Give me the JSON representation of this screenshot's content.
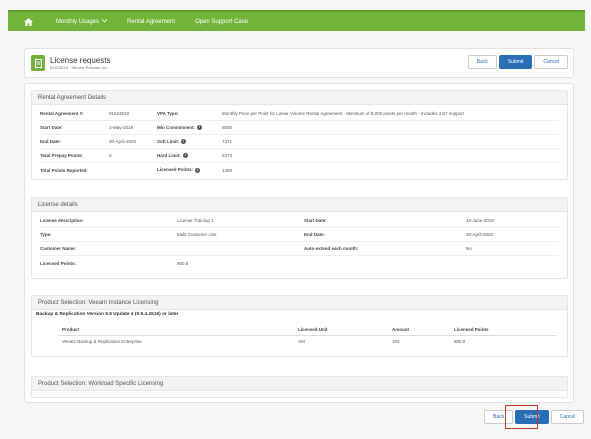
{
  "nav": {
    "items": [
      "Monthly Usages",
      "Rental Agreement",
      "Open Support Case"
    ]
  },
  "header": {
    "title": "License requests",
    "subtitle": "81623918 · Service Provider Inc",
    "back": "Back",
    "submit": "Submit",
    "cancel": "Cancel"
  },
  "rental": {
    "section_title": "Rental Agreement Details",
    "agreement_label": "Rental Agreement #:",
    "agreement_value": "01623918",
    "vpa_label": "VPA Type:",
    "vpa_value": "Monthly Price per Point for Linear Volume Rental Agreement - Minimum of 8,000 points per month - Includes 24/7 support",
    "start_label": "Start Date:",
    "start_value": "1-May-2019",
    "min_label": "Min Commitment:",
    "min_value": "5000",
    "end_label": "End Date:",
    "end_value": "30-April-2020",
    "soft_label": "Soft Limit:",
    "soft_value": "7371",
    "prepay_label": "Total Prepay Points:",
    "prepay_value": "0",
    "hard_label": "Hard Limit:",
    "hard_value": "8373",
    "reported_label": "Total Points Reported:",
    "licensed_label": "Licensed Points:",
    "licensed_value": "1400"
  },
  "license": {
    "section_title": "License details",
    "desc_label": "License description:",
    "desc_value": "License Training 1",
    "start_label": "Start Date:",
    "start_value": "16-June-2019",
    "type_label": "Type:",
    "type_value": "Multi Customer Use",
    "end_label": "End Date:",
    "end_value": "30-April-2020",
    "customer_label": "Customer Name:",
    "auto_label": "Auto-extend each month:",
    "auto_value": "No",
    "points_label": "Licensed Points:",
    "points_value": "900.0"
  },
  "product1": {
    "section_title": "Product Selection: Veeam Instance Licensing",
    "group": "Backup & Replication Version 9.5 Update 4 (9.5.4.2615) or later",
    "headers": [
      "Product",
      "Licensed Unit",
      "Amount",
      "Licensed Points"
    ],
    "row": [
      "Veeam Backup & Replication Enterprise",
      "VM",
      "100",
      "900.0"
    ]
  },
  "product2": {
    "section_title": "Product Selection: Workload Specific Licensing"
  },
  "footer": {
    "back": "Back",
    "submit": "Submit",
    "cancel": "Cancel"
  }
}
